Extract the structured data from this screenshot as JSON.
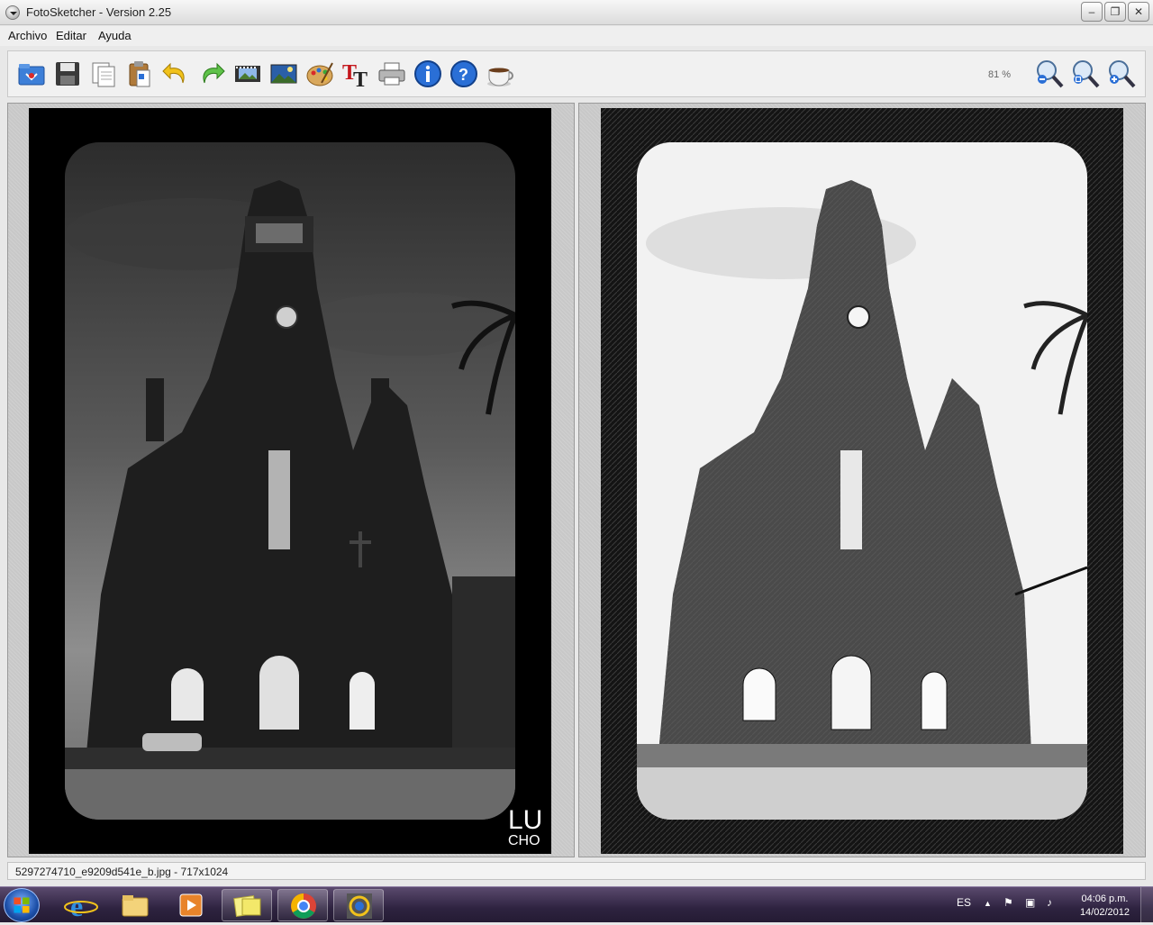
{
  "window": {
    "title": "FotoSketcher - Version 2.25",
    "minimize_label": "–",
    "restore_label": "❐",
    "close_label": "✕"
  },
  "menu": {
    "items": [
      {
        "label": "Archivo"
      },
      {
        "label": "Editar"
      },
      {
        "label": "Ayuda"
      }
    ]
  },
  "toolbar": {
    "zoom_level": "81 %",
    "icons": [
      "open-icon",
      "save-icon",
      "copy-icon",
      "paste-icon",
      "undo-icon",
      "redo-icon",
      "filmstrip-icon",
      "landscape-icon",
      "palette-icon",
      "text-icon",
      "print-icon",
      "info-icon",
      "help-icon",
      "coffee-icon",
      "zoom-out-icon",
      "zoom-fit-icon",
      "zoom-in-icon"
    ]
  },
  "left_image": {
    "watermark_line1": "LU",
    "watermark_line2": "CHO"
  },
  "status": {
    "file_info": "5297274710_e9209d541e_b.jpg - 717x1024"
  },
  "taskbar": {
    "language": "ES",
    "time": "04:06 p.m.",
    "date": "14/02/2012"
  },
  "colors": {
    "accent_blue": "#2a6fd6",
    "taskbar_purple": "#2e2340"
  }
}
